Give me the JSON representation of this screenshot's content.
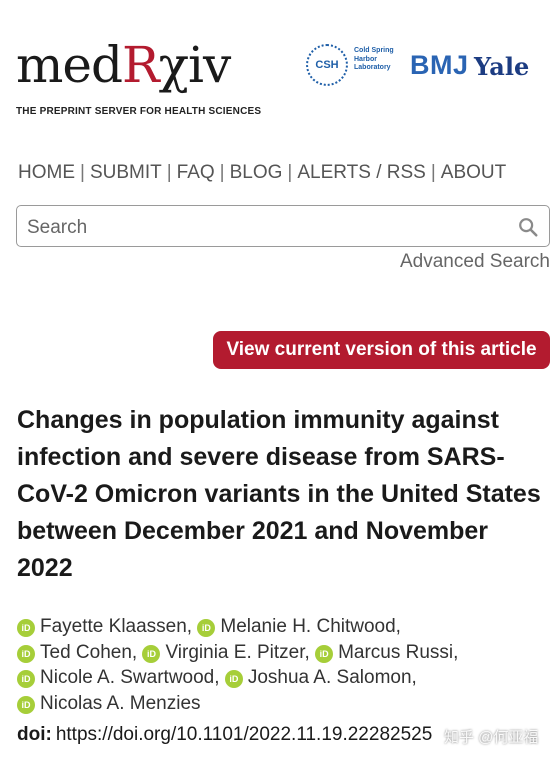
{
  "header": {
    "logo_prefix": "med",
    "logo_accent": "R",
    "logo_suffix": "χiv",
    "tagline": "THE PREPRINT SERVER FOR HEALTH SCIENCES",
    "partners": {
      "csh_mark": "CSH",
      "csh_text": "Cold Spring Harbor Laboratory",
      "bmj": "BMJ",
      "yale": "Yale"
    }
  },
  "nav": {
    "items": [
      "HOME",
      "SUBMIT",
      "FAQ",
      "BLOG",
      "ALERTS / RSS",
      "ABOUT"
    ],
    "separator": "|"
  },
  "search": {
    "placeholder": "Search",
    "icon": "search-icon",
    "advanced_label": "Advanced Search"
  },
  "cta": {
    "label": "View current version of this article"
  },
  "article": {
    "title": "Changes in population immunity against infection and severe disease from SARS-CoV-2 Omicron variants in the United States between December 2021 and November 2022",
    "orcid_icon_text": "iD",
    "authors": [
      "Fayette Klaassen,",
      "Melanie H. Chitwood,",
      "Ted Cohen,",
      "Virginia E. Pitzer,",
      "Marcus Russi,",
      "Nicole A. Swartwood,",
      "Joshua A. Salomon,",
      "Nicolas A. Menzies"
    ],
    "doi_label": "doi:",
    "doi_value": "https://doi.org/10.1101/2022.11.19.22282525"
  },
  "watermark": "知乎 @何亚福",
  "colors": {
    "brand": "#b31b2f",
    "orcid": "#a6ce39",
    "nav_text": "#555555"
  }
}
